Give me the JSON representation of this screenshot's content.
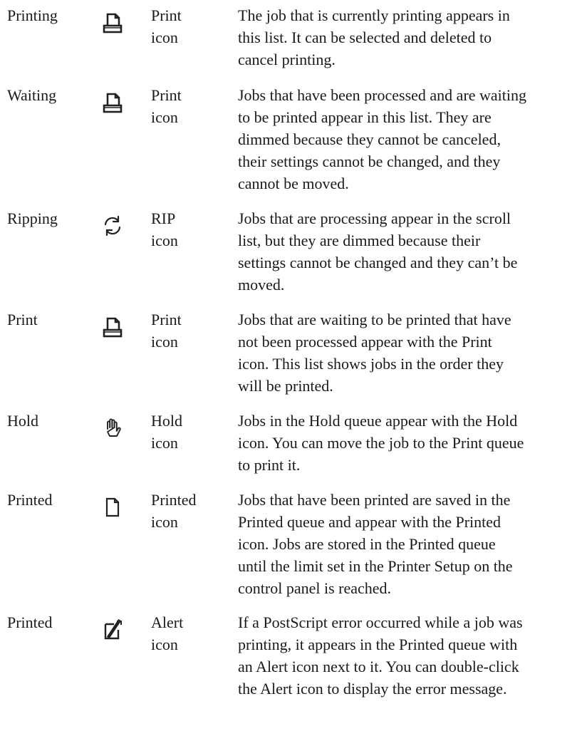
{
  "rows": [
    {
      "state": "Printing",
      "icon": "print-icon",
      "icon_label": [
        "Print",
        "icon"
      ],
      "description": [
        "The job that is currently printing appears in",
        "this list. It can be selected and deleted to",
        "cancel printing."
      ]
    },
    {
      "state": "Waiting",
      "icon": "print-icon",
      "icon_label": [
        "Print",
        "icon"
      ],
      "description": [
        "Jobs that have been processed and are waiting",
        "to be printed appear in this list. They are",
        "dimmed because they cannot be canceled,",
        "their settings cannot be changed, and they",
        "cannot be moved."
      ]
    },
    {
      "state": "Ripping",
      "icon": "rip-icon",
      "icon_label": [
        "RIP",
        "icon"
      ],
      "description": [
        "Jobs that are processing appear in the scroll",
        "list, but they are dimmed because their",
        "settings cannot be changed and they can’t be",
        "moved."
      ]
    },
    {
      "state": "Print",
      "icon": "print-icon",
      "icon_label": [
        "Print",
        "icon"
      ],
      "description": [
        "Jobs that are waiting to be printed that have",
        "not been processed appear with the Print",
        "icon. This list shows jobs in the order they",
        "will be printed."
      ]
    },
    {
      "state": "Hold",
      "icon": "hold-icon",
      "icon_label": [
        "Hold",
        "icon"
      ],
      "description": [
        "Jobs in the Hold queue appear with the Hold",
        "icon. You can move the job to the Print queue",
        "to print it."
      ]
    },
    {
      "state": "Printed",
      "icon": "printed-icon",
      "icon_label": [
        "Printed",
        " icon"
      ],
      "description": [
        "Jobs that have been printed are saved in the",
        "Printed queue and appear with the Printed",
        "icon. Jobs are stored in the Printed queue",
        "until the limit set in the Printer Setup on the",
        "control panel is reached."
      ]
    },
    {
      "state": "Printed",
      "icon": "alert-icon",
      "icon_label": [
        "Alert",
        "icon"
      ],
      "description": [
        "If a PostScript error occurred while a job was",
        "printing, it appears in the Printed queue with",
        "an Alert icon next to it. You can double-click",
        "the Alert icon to display the error message."
      ]
    }
  ]
}
